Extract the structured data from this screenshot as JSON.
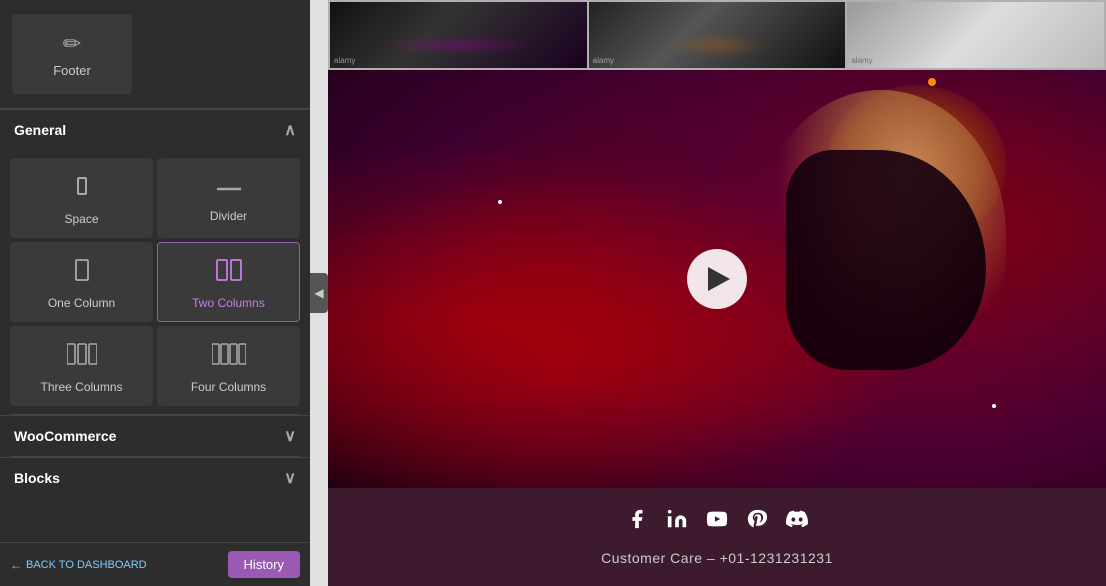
{
  "sidebar": {
    "footer_label": "Footer",
    "sections": {
      "general": {
        "label": "General",
        "expanded": true,
        "items": [
          {
            "id": "space",
            "label": "Space",
            "icon": "⬚"
          },
          {
            "id": "divider",
            "label": "Divider",
            "icon": "—"
          },
          {
            "id": "one-column",
            "label": "One Column",
            "icon": "▭",
            "highlighted": false
          },
          {
            "id": "two-columns",
            "label": "Two Columns",
            "icon": "⬛⬛",
            "highlighted": true
          },
          {
            "id": "three-columns",
            "label": "Three Columns",
            "icon": "⬛⬛⬛",
            "highlighted": false
          },
          {
            "id": "four-columns",
            "label": "Four Columns",
            "icon": "⬛⬛⬛⬛",
            "highlighted": false
          }
        ]
      },
      "woocommerce": {
        "label": "WooCommerce",
        "expanded": false
      },
      "blocks": {
        "label": "Blocks",
        "expanded": false
      }
    },
    "bottom": {
      "back_label": "← BACK TO DASHBOARD",
      "history_label": "History"
    }
  },
  "main": {
    "thumbnails": [
      {
        "id": "thumb1",
        "watermark": "alamy"
      },
      {
        "id": "thumb2",
        "watermark": "alamy"
      },
      {
        "id": "thumb3",
        "watermark": "alamy"
      }
    ],
    "video": {
      "play_label": "Play",
      "orange_dot": true,
      "white_dots": true
    },
    "footer": {
      "social_icons": [
        {
          "id": "facebook",
          "symbol": "f",
          "label": "Facebook"
        },
        {
          "id": "linkedin",
          "symbol": "in",
          "label": "LinkedIn"
        },
        {
          "id": "youtube",
          "symbol": "▶",
          "label": "YouTube"
        },
        {
          "id": "pinterest",
          "symbol": "P",
          "label": "Pinterest"
        },
        {
          "id": "discord",
          "symbol": "◉",
          "label": "Discord"
        }
      ],
      "customer_care": "Customer Care – +01-1231231231"
    }
  },
  "collapse_icon": "◀"
}
